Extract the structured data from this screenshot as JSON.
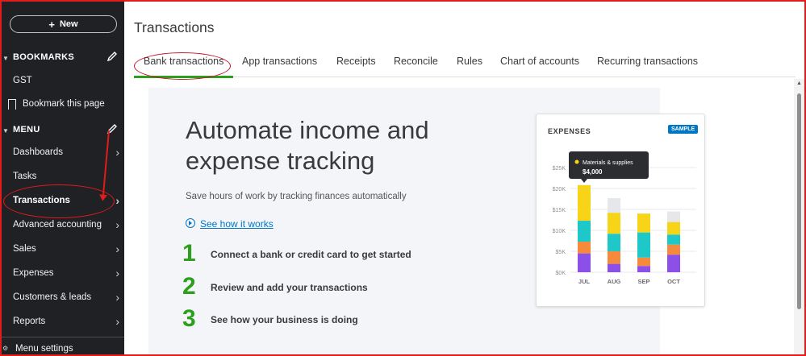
{
  "sidebar": {
    "new_label": "New",
    "bookmarks_header": "BOOKMARKS",
    "bookmark_items": [
      "GST"
    ],
    "bookmark_this_page": "Bookmark this page",
    "menu_header": "MENU",
    "menu_items": [
      "Dashboards",
      "Tasks",
      "Transactions",
      "Advanced accounting",
      "Sales",
      "Expenses",
      "Customers & leads",
      "Reports"
    ],
    "menu_settings": "Menu settings"
  },
  "page": {
    "title": "Transactions",
    "tabs": [
      "Bank transactions",
      "App transactions",
      "Receipts",
      "Reconcile",
      "Rules",
      "Chart of accounts",
      "Recurring transactions"
    ],
    "active_tab": "Bank transactions"
  },
  "promo": {
    "headline": "Automate income and expense tracking",
    "subtitle": "Save hours of work by tracking finances automatically",
    "link": "See how it works",
    "steps": [
      {
        "num": "1",
        "text": "Connect a bank or credit card to get started"
      },
      {
        "num": "2",
        "text": "Review and add your transactions"
      },
      {
        "num": "3",
        "text": "See how your business is doing"
      }
    ]
  },
  "chart_data": {
    "type": "bar",
    "title": "EXPENSES",
    "badge": "SAMPLE",
    "categories": [
      "JUL",
      "AUG",
      "SEP",
      "OCT"
    ],
    "y_ticks": [
      "$0K",
      "$5K",
      "$10K",
      "$15K",
      "$20K",
      "$25K"
    ],
    "ylim": [
      0,
      25000
    ],
    "series": [
      {
        "color": "#8c4fe8",
        "values": [
          4500,
          2000,
          1500,
          4200
        ]
      },
      {
        "color": "#f58a3d",
        "values": [
          2800,
          3000,
          2000,
          2400
        ]
      },
      {
        "color": "#1ec8c8",
        "values": [
          5000,
          4200,
          6000,
          2400
        ]
      },
      {
        "color": "#f7d417",
        "values": [
          8500,
          5000,
          4500,
          3000
        ]
      },
      {
        "color": "#e6e7ea",
        "values": [
          0,
          3500,
          0,
          2500
        ]
      }
    ],
    "tooltip": {
      "label": "Materials & supplies",
      "value": "$4,000",
      "color": "#f7d417"
    }
  },
  "colors": {
    "accent": "#2ca01c",
    "link": "#0077c5",
    "annotation": "#e21b1b"
  }
}
